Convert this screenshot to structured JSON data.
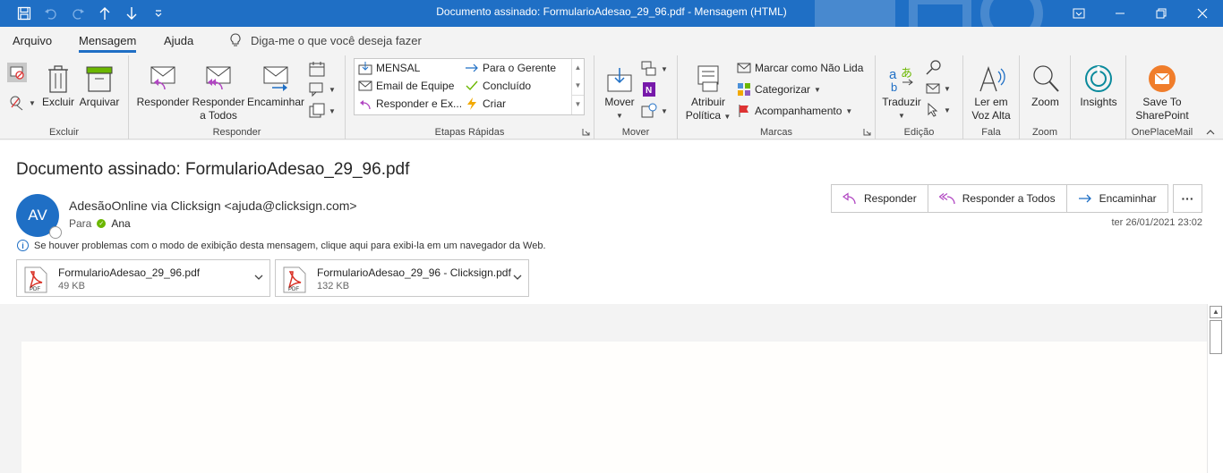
{
  "window": {
    "title": "Documento assinado: FormularioAdesao_29_96.pdf  -  Mensagem (HTML)"
  },
  "menu": {
    "tabs": [
      "Arquivo",
      "Mensagem",
      "Ajuda"
    ],
    "active_tab": "Mensagem",
    "tell_me": "Diga-me o que você deseja fazer"
  },
  "ribbon": {
    "excluir": {
      "label": "Excluir",
      "delete_btn": "Excluir",
      "archive_btn": "Arquivar"
    },
    "responder": {
      "label": "Responder",
      "reply": "Responder",
      "reply_all_1": "Responder",
      "reply_all_2": "a Todos",
      "forward": "Encaminhar"
    },
    "etapas": {
      "label": "Etapas Rápidas",
      "items": [
        "MENSAL",
        "Para o Gerente",
        "Email de Equipe",
        "Concluído",
        "Responder e Ex...",
        "Criar"
      ]
    },
    "mover": {
      "label": "Mover",
      "move": "Mover"
    },
    "marcas": {
      "label": "Marcas",
      "policy_1": "Atribuir",
      "policy_2": "Política",
      "unread": "Marcar como Não Lida",
      "categorize": "Categorizar",
      "followup": "Acompanhamento"
    },
    "edicao": {
      "label": "Edição",
      "translate": "Traduzir"
    },
    "fala": {
      "label": "Fala",
      "read_1": "Ler em",
      "read_2": "Voz Alta"
    },
    "zoom": {
      "label": "Zoom",
      "zoom": "Zoom"
    },
    "insights": {
      "label": "Insights"
    },
    "onplacemail": {
      "label": "OnePlaceMail",
      "save_1": "Save To",
      "save_2": "SharePoint"
    }
  },
  "message": {
    "subject": "Documento assinado: FormularioAdesao_29_96.pdf",
    "avatar_initials": "AV",
    "sender": "AdesãoOnline via Clicksign <ajuda@clicksign.com>",
    "to_label": "Para",
    "to_name": "Ana",
    "date": "ter 26/01/2021 23:02",
    "info_bar": "Se houver problemas com o modo de exibição desta mensagem, clique aqui para exibi-la em um navegador da Web.",
    "actions": {
      "reply": "Responder",
      "reply_all": "Responder a Todos",
      "forward": "Encaminhar"
    },
    "attachments": [
      {
        "name": "FormularioAdesao_29_96.pdf",
        "size": "49 KB"
      },
      {
        "name": "FormularioAdesao_29_96 - Clicksign.pdf",
        "size": "132 KB"
      }
    ]
  },
  "colors": {
    "accent": "#1f6fc5",
    "presence": "#6bb700",
    "pdf": "#d93025"
  }
}
